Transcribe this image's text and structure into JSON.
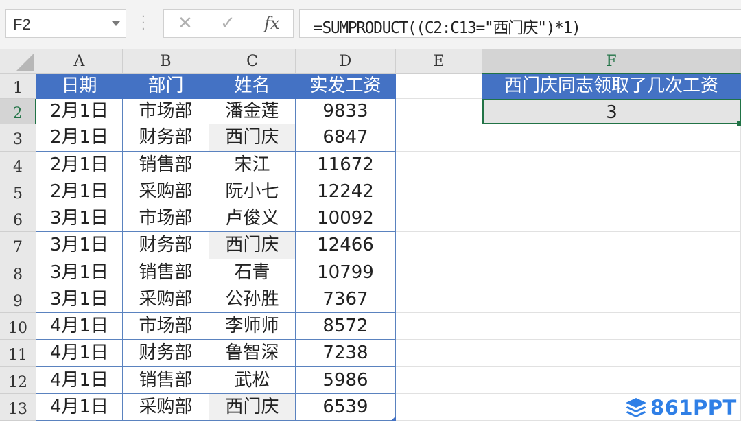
{
  "namebox": {
    "value": "F2"
  },
  "formula_bar": {
    "cancel_icon": "✕",
    "confirm_icon": "✓",
    "fx_label": "fx",
    "formula": "=SUMPRODUCT((C2:C13=\"西门庆\")*1)"
  },
  "columns": [
    "A",
    "B",
    "C",
    "D",
    "E",
    "F"
  ],
  "rows": [
    "1",
    "2",
    "3",
    "4",
    "5",
    "6",
    "7",
    "8",
    "9",
    "10",
    "11",
    "12",
    "13"
  ],
  "table": {
    "headers": [
      "日期",
      "部门",
      "姓名",
      "实发工资"
    ],
    "rows": [
      [
        "2月1日",
        "市场部",
        "潘金莲",
        "9833"
      ],
      [
        "2月1日",
        "财务部",
        "西门庆",
        "6847"
      ],
      [
        "2月1日",
        "销售部",
        "宋江",
        "11672"
      ],
      [
        "2月1日",
        "采购部",
        "阮小七",
        "12242"
      ],
      [
        "3月1日",
        "市场部",
        "卢俊义",
        "10092"
      ],
      [
        "3月1日",
        "财务部",
        "西门庆",
        "12466"
      ],
      [
        "3月1日",
        "销售部",
        "石青",
        "10799"
      ],
      [
        "3月1日",
        "采购部",
        "公孙胜",
        "7367"
      ],
      [
        "4月1日",
        "市场部",
        "李师师",
        "8572"
      ],
      [
        "4月1日",
        "财务部",
        "鲁智深",
        "7238"
      ],
      [
        "4月1日",
        "销售部",
        "武松",
        "5986"
      ],
      [
        "4月1日",
        "采购部",
        "西门庆",
        "6539"
      ]
    ]
  },
  "result": {
    "header": "西门庆同志领取了几次工资",
    "value": "3"
  },
  "selected_cell": "F2",
  "highlight_name": "西门庆",
  "watermark": {
    "text": "861PPT"
  },
  "colors": {
    "table_header_bg": "#4472c4",
    "selection_border": "#217346",
    "watermark": "#2f7fe6"
  }
}
